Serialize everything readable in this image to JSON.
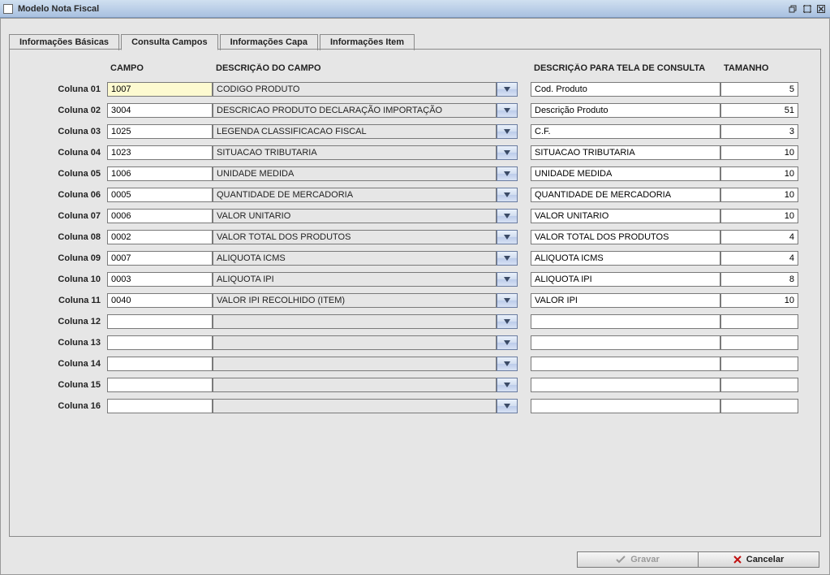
{
  "window": {
    "title": "Modelo Nota Fiscal"
  },
  "tabs": [
    {
      "label": "Informações Básicas"
    },
    {
      "label": "Consulta Campos"
    },
    {
      "label": "Informações Capa"
    },
    {
      "label": "Informações Item"
    }
  ],
  "headers": {
    "campo": "CAMPO",
    "descricao": "DESCRIÇÃO DO CAMPO",
    "tela_consulta": "DESCRIÇÃO PARA TELA DE CONSULTA",
    "tamanho": "TAMANHO"
  },
  "footer": {
    "gravar": "Gravar",
    "cancelar": "Cancelar"
  },
  "rows": [
    {
      "label": "Coluna 01",
      "campo": "1007",
      "desc": "CODIGO PRODUTO",
      "query": "Cod. Produto",
      "tamanho": "5"
    },
    {
      "label": "Coluna 02",
      "campo": "3004",
      "desc": "DESCRICAO PRODUTO DECLARAÇÃO IMPORTAÇÃO",
      "query": "Descrição Produto",
      "tamanho": "51"
    },
    {
      "label": "Coluna 03",
      "campo": "1025",
      "desc": "LEGENDA CLASSIFICACAO FISCAL",
      "query": "C.F.",
      "tamanho": "3"
    },
    {
      "label": "Coluna 04",
      "campo": "1023",
      "desc": "SITUACAO TRIBUTARIA",
      "query": "SITUACAO TRIBUTARIA",
      "tamanho": "10"
    },
    {
      "label": "Coluna 05",
      "campo": "1006",
      "desc": "UNIDADE MEDIDA",
      "query": "UNIDADE MEDIDA",
      "tamanho": "10"
    },
    {
      "label": "Coluna 06",
      "campo": "0005",
      "desc": "QUANTIDADE DE MERCADORIA",
      "query": "QUANTIDADE DE MERCADORIA",
      "tamanho": "10"
    },
    {
      "label": "Coluna 07",
      "campo": "0006",
      "desc": "VALOR UNITARIO",
      "query": "VALOR UNITARIO",
      "tamanho": "10"
    },
    {
      "label": "Coluna 08",
      "campo": "0002",
      "desc": "VALOR TOTAL DOS PRODUTOS",
      "query": "VALOR TOTAL DOS PRODUTOS",
      "tamanho": "4"
    },
    {
      "label": "Coluna 09",
      "campo": "0007",
      "desc": "ALIQUOTA ICMS",
      "query": "ALIQUOTA ICMS",
      "tamanho": "4"
    },
    {
      "label": "Coluna 10",
      "campo": "0003",
      "desc": "ALIQUOTA IPI",
      "query": "ALIQUOTA IPI",
      "tamanho": "8"
    },
    {
      "label": "Coluna 11",
      "campo": "0040",
      "desc": "VALOR IPI RECOLHIDO (ITEM)",
      "query": "VALOR IPI",
      "tamanho": "10"
    },
    {
      "label": "Coluna 12",
      "campo": "",
      "desc": "",
      "query": "",
      "tamanho": ""
    },
    {
      "label": "Coluna 13",
      "campo": "",
      "desc": "",
      "query": "",
      "tamanho": ""
    },
    {
      "label": "Coluna 14",
      "campo": "",
      "desc": "",
      "query": "",
      "tamanho": ""
    },
    {
      "label": "Coluna 15",
      "campo": "",
      "desc": "",
      "query": "",
      "tamanho": ""
    },
    {
      "label": "Coluna 16",
      "campo": "",
      "desc": "",
      "query": "",
      "tamanho": ""
    }
  ]
}
